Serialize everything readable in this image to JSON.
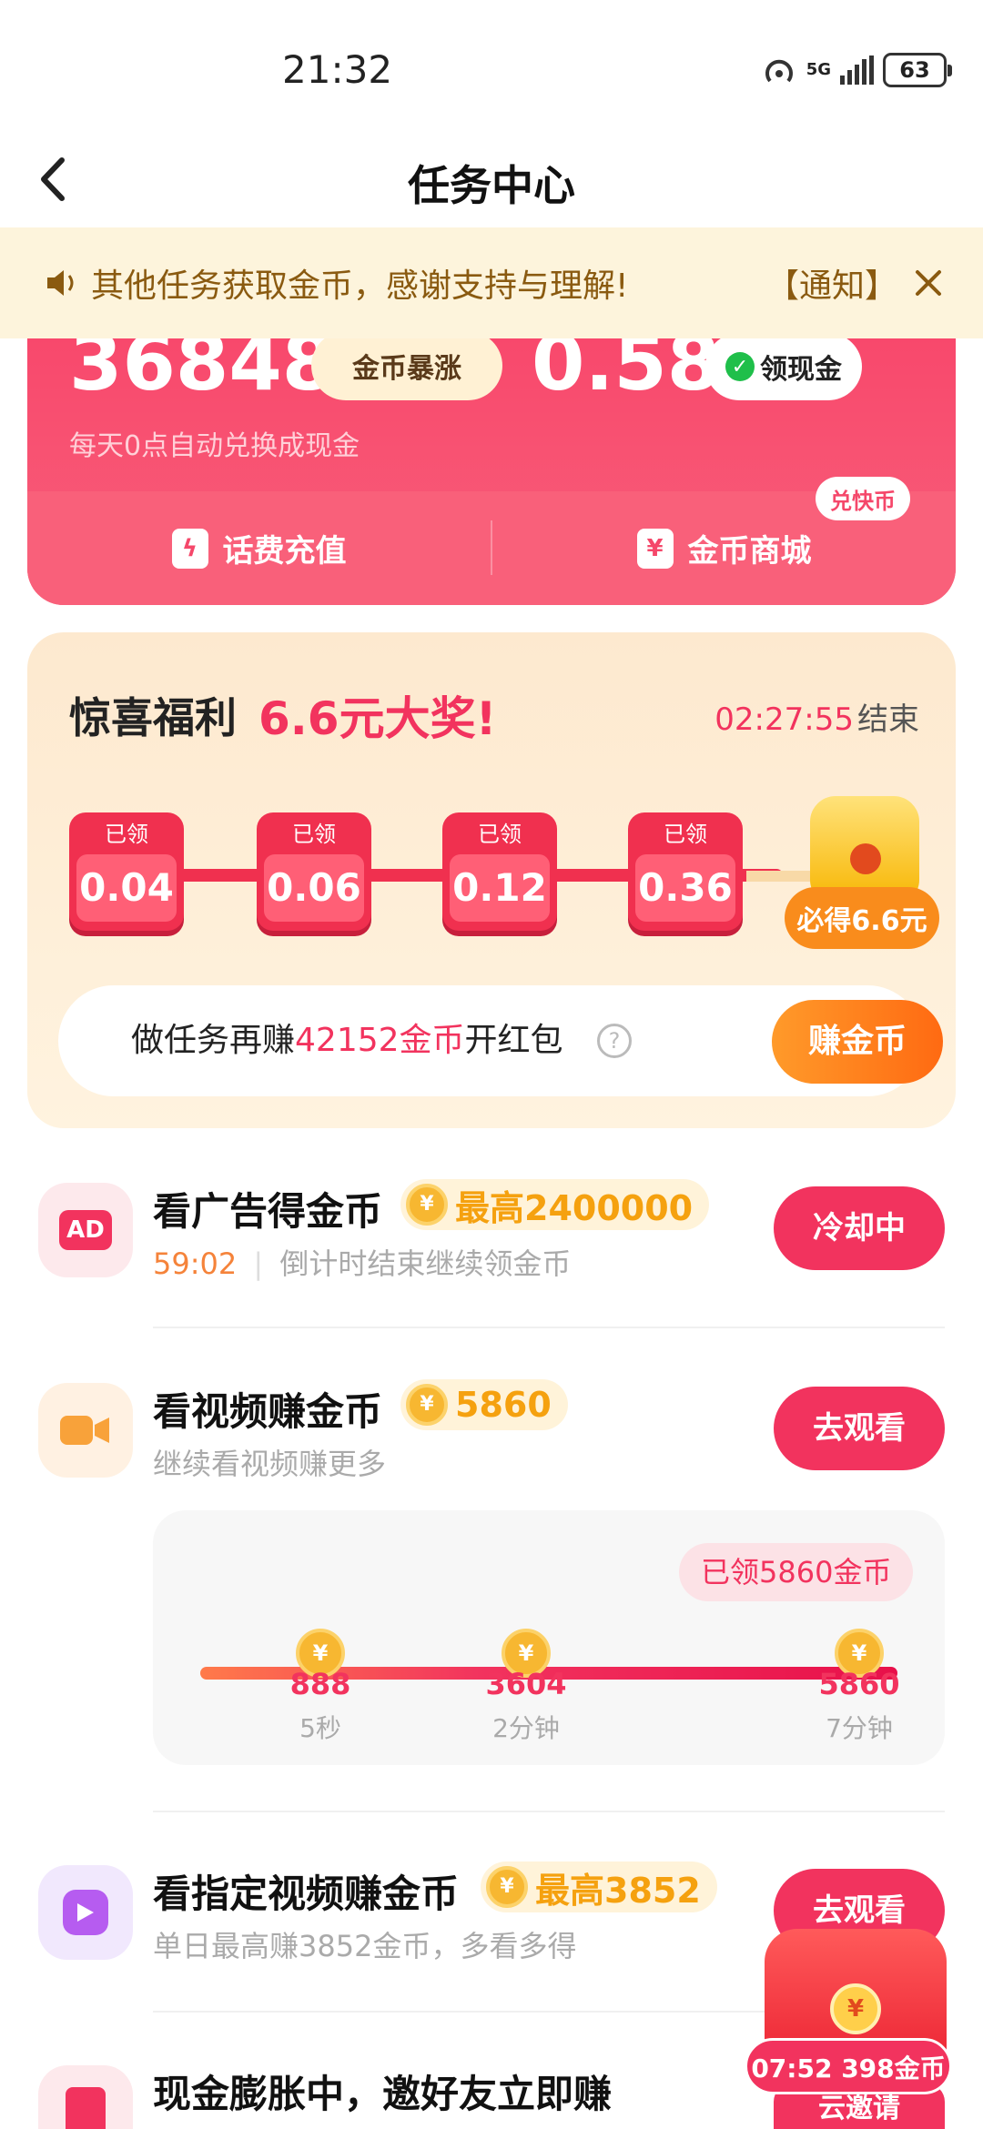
{
  "status": {
    "time": "21:32",
    "network": "5G",
    "battery": "63"
  },
  "nav": {
    "title": "任务中心"
  },
  "notice": {
    "text": "其他任务获取金币，感谢支持与理解!",
    "tag": "【通知】"
  },
  "coins": {
    "amount": "36848",
    "boost_label": "金币暴涨",
    "cash": "0.58",
    "cash_btn": "领现金",
    "subtitle": "每天0点自动兑换成现金",
    "recharge": "话费充值",
    "mall": "金币商城",
    "mall_badge": "兑快币"
  },
  "bonus": {
    "title": "惊喜福利",
    "prize": "6.6元大奖!",
    "timer": "02:27:55",
    "timer_suffix": "结束",
    "steps": [
      {
        "label": "已领",
        "value": "0.04"
      },
      {
        "label": "已领",
        "value": "0.06"
      },
      {
        "label": "已领",
        "value": "0.12"
      },
      {
        "label": "已领",
        "value": "0.36"
      }
    ],
    "final_tag": "必得6.6元",
    "task_prefix": "做任务再赚",
    "task_highlight": "42152金币",
    "task_suffix": "开红包",
    "earn_btn": "赚金币"
  },
  "tasks": [
    {
      "title": "看广告得金币",
      "reward": "最高2400000",
      "countdown": "59:02",
      "subtitle": "倒计时结束继续领金币",
      "button": "冷却中",
      "icon_text": "AD"
    },
    {
      "title": "看视频赚金币",
      "reward": "5860",
      "subtitle": "继续看视频赚更多",
      "button": "去观看"
    },
    {
      "title": "看指定视频赚金币",
      "reward": "最高3852",
      "subtitle": "单日最高赚3852金币，多看多得",
      "button": "去观看"
    },
    {
      "title": "现金膨胀中，邀好友立即赚",
      "button": "云邀请"
    }
  ],
  "video_progress": {
    "claimed": "已领5860金币",
    "nodes": [
      {
        "value": "888",
        "time": "5秒"
      },
      {
        "value": "3604",
        "time": "2分钟"
      },
      {
        "value": "5860",
        "time": "7分钟"
      }
    ]
  },
  "float": {
    "text": "07:52 398金币"
  },
  "colors": {
    "accent": "#f2335e",
    "gold": "#f5a10f",
    "notice_bg": "#fdf4dc"
  }
}
